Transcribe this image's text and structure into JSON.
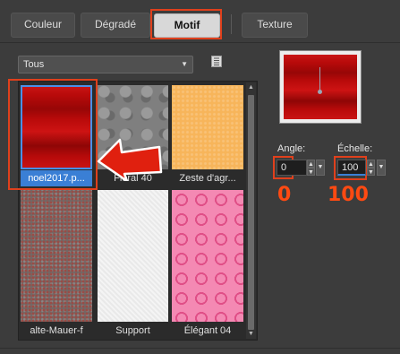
{
  "tabs": [
    {
      "label": "Couleur"
    },
    {
      "label": "Dégradé"
    },
    {
      "label": "Motif"
    },
    {
      "label": "Texture"
    }
  ],
  "category_dropdown": {
    "value": "Tous"
  },
  "patterns": [
    {
      "name": "noel2017.p..."
    },
    {
      "name": "Floral 40"
    },
    {
      "name": "Zeste d'agr..."
    },
    {
      "name": "alte-Mauer-f"
    },
    {
      "name": "Support"
    },
    {
      "name": "Élégant 04"
    }
  ],
  "angle": {
    "label": "Angle:",
    "value": "0"
  },
  "scale": {
    "label": "Échelle:",
    "value": "100"
  },
  "annotations": {
    "angle_value": "0",
    "scale_value": "100"
  },
  "icons": {
    "library": "book-icon",
    "arrow": "red-arrow-icon",
    "chevron": "chevron-down-icon"
  },
  "colors": {
    "highlight": "#e0401c",
    "selection": "#3a7fd5",
    "annotation_text": "#ff4a12"
  }
}
